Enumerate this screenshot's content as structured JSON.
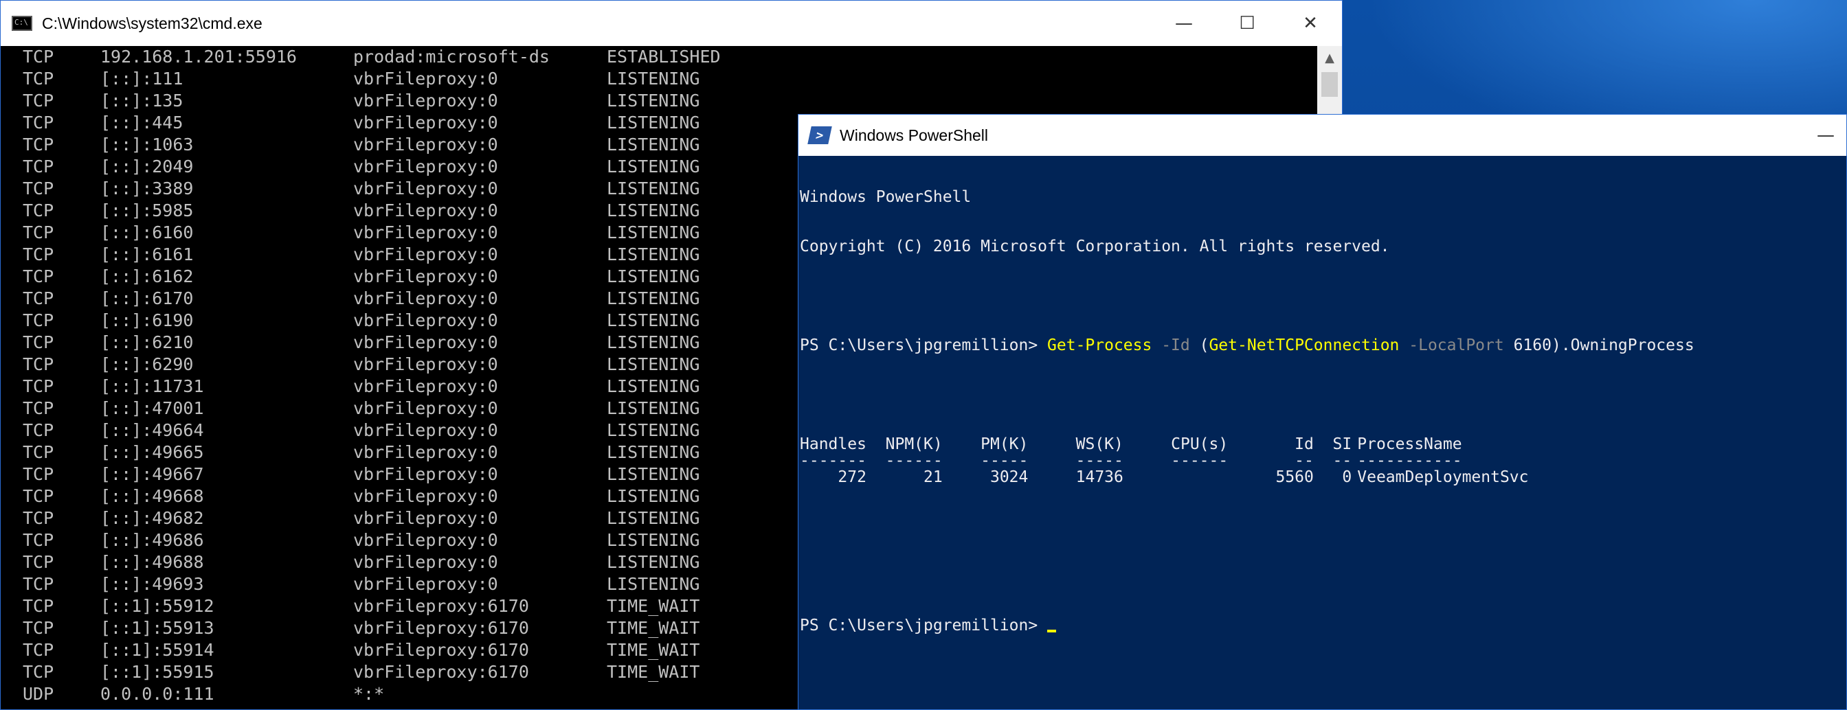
{
  "cmd": {
    "title": "C:\\Windows\\system32\\cmd.exe",
    "icon_label": "C:\\",
    "controls": {
      "minimize": "—",
      "maximize": "☐",
      "close": "✕"
    },
    "scroll_up": "▲",
    "rows": [
      [
        "TCP",
        "192.168.1.201:55916",
        "prodad:microsoft-ds",
        "ESTABLISHED"
      ],
      [
        "TCP",
        "[::]:111",
        "vbrFileproxy:0",
        "LISTENING"
      ],
      [
        "TCP",
        "[::]:135",
        "vbrFileproxy:0",
        "LISTENING"
      ],
      [
        "TCP",
        "[::]:445",
        "vbrFileproxy:0",
        "LISTENING"
      ],
      [
        "TCP",
        "[::]:1063",
        "vbrFileproxy:0",
        "LISTENING"
      ],
      [
        "TCP",
        "[::]:2049",
        "vbrFileproxy:0",
        "LISTENING"
      ],
      [
        "TCP",
        "[::]:3389",
        "vbrFileproxy:0",
        "LISTENING"
      ],
      [
        "TCP",
        "[::]:5985",
        "vbrFileproxy:0",
        "LISTENING"
      ],
      [
        "TCP",
        "[::]:6160",
        "vbrFileproxy:0",
        "LISTENING"
      ],
      [
        "TCP",
        "[::]:6161",
        "vbrFileproxy:0",
        "LISTENING"
      ],
      [
        "TCP",
        "[::]:6162",
        "vbrFileproxy:0",
        "LISTENING"
      ],
      [
        "TCP",
        "[::]:6170",
        "vbrFileproxy:0",
        "LISTENING"
      ],
      [
        "TCP",
        "[::]:6190",
        "vbrFileproxy:0",
        "LISTENING"
      ],
      [
        "TCP",
        "[::]:6210",
        "vbrFileproxy:0",
        "LISTENING"
      ],
      [
        "TCP",
        "[::]:6290",
        "vbrFileproxy:0",
        "LISTENING"
      ],
      [
        "TCP",
        "[::]:11731",
        "vbrFileproxy:0",
        "LISTENING"
      ],
      [
        "TCP",
        "[::]:47001",
        "vbrFileproxy:0",
        "LISTENING"
      ],
      [
        "TCP",
        "[::]:49664",
        "vbrFileproxy:0",
        "LISTENING"
      ],
      [
        "TCP",
        "[::]:49665",
        "vbrFileproxy:0",
        "LISTENING"
      ],
      [
        "TCP",
        "[::]:49667",
        "vbrFileproxy:0",
        "LISTENING"
      ],
      [
        "TCP",
        "[::]:49668",
        "vbrFileproxy:0",
        "LISTENING"
      ],
      [
        "TCP",
        "[::]:49682",
        "vbrFileproxy:0",
        "LISTENING"
      ],
      [
        "TCP",
        "[::]:49686",
        "vbrFileproxy:0",
        "LISTENING"
      ],
      [
        "TCP",
        "[::]:49688",
        "vbrFileproxy:0",
        "LISTENING"
      ],
      [
        "TCP",
        "[::]:49693",
        "vbrFileproxy:0",
        "LISTENING"
      ],
      [
        "TCP",
        "[::1]:55912",
        "vbrFileproxy:6170",
        "TIME_WAIT"
      ],
      [
        "TCP",
        "[::1]:55913",
        "vbrFileproxy:6170",
        "TIME_WAIT"
      ],
      [
        "TCP",
        "[::1]:55914",
        "vbrFileproxy:6170",
        "TIME_WAIT"
      ],
      [
        "TCP",
        "[::1]:55915",
        "vbrFileproxy:6170",
        "TIME_WAIT"
      ],
      [
        "UDP",
        "0.0.0.0:111",
        "*:*",
        ""
      ]
    ]
  },
  "powershell": {
    "title": "Windows PowerShell",
    "minimize": "—",
    "banner_line1": "Windows PowerShell",
    "banner_line2": "Copyright (C) 2016 Microsoft Corporation. All rights reserved.",
    "prompt": "PS C:\\Users\\jpgremillion> ",
    "command": {
      "cmdlet1": "Get-Process",
      "param1": " -Id",
      "open": " (",
      "cmdlet2": "Get-NetTCPConnection",
      "param2": " -LocalPort",
      "value": " 6160",
      "tail": ").OwningProcess"
    },
    "table": {
      "headers": [
        "Handles",
        "NPM(K)",
        "PM(K)",
        "WS(K)",
        "CPU(s)",
        "Id",
        "SI",
        "ProcessName"
      ],
      "underline": [
        "-------",
        "------",
        "-----",
        "-----",
        "------",
        "--",
        "--",
        "-----------"
      ],
      "row": [
        "272",
        "21",
        "3024",
        "14736",
        "",
        "5560",
        "0",
        "VeeamDeploymentSvc"
      ]
    },
    "prompt2": "PS C:\\Users\\jpgremillion> "
  }
}
